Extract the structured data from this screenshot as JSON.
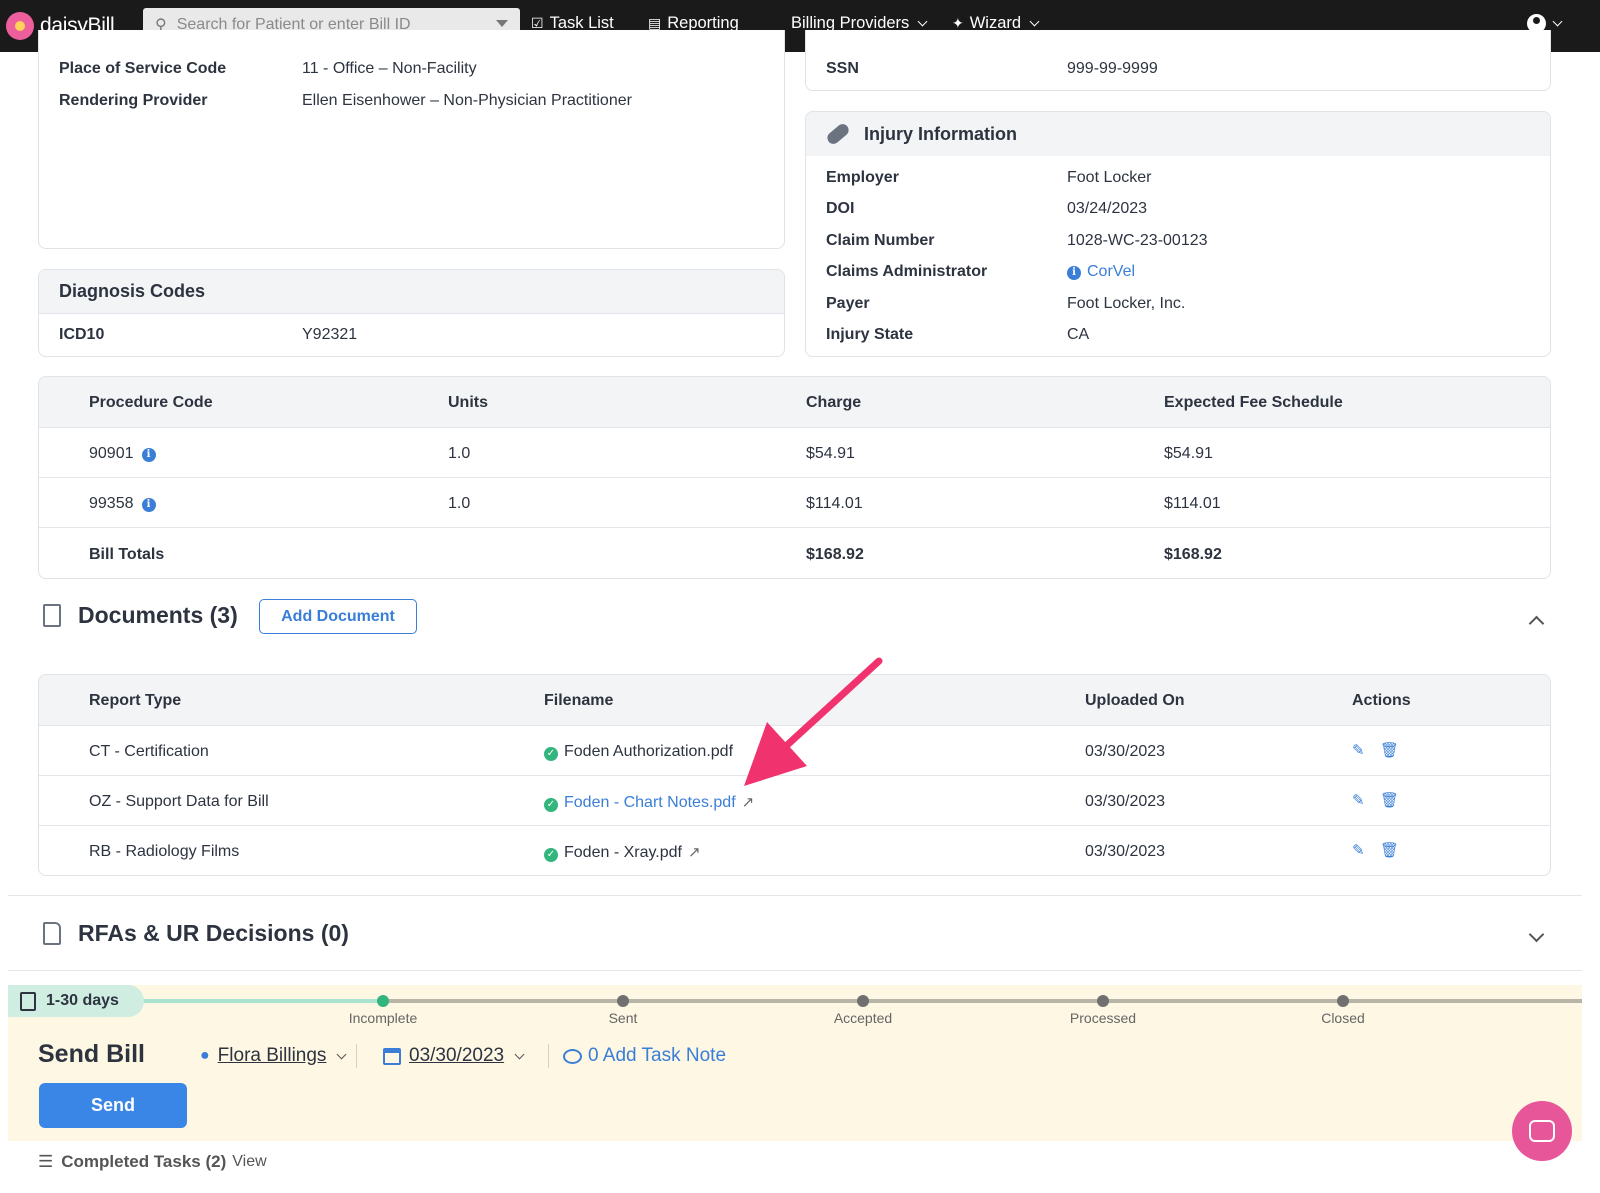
{
  "app": {
    "logo_text": "daisyBill"
  },
  "nav": {
    "search_placeholder": "Search for Patient or enter Bill ID",
    "task_list": "Task List",
    "reporting": "Reporting",
    "billing_providers": "Billing Providers",
    "wizard": "Wizard"
  },
  "service": {
    "rows": [
      {
        "label": "Place of Service Code",
        "value": "11 - Office – Non-Facility"
      },
      {
        "label": "Rendering Provider",
        "value": "Ellen Eisenhower – Non-Physician Practitioner"
      }
    ]
  },
  "patient": {
    "ssn_label": "SSN",
    "ssn_value": "999-99-9999"
  },
  "injury": {
    "title": "Injury Information",
    "rows": [
      {
        "label": "Employer",
        "value": "Foot Locker"
      },
      {
        "label": "DOI",
        "value": "03/24/2023"
      },
      {
        "label": "Claim Number",
        "value": "1028-WC-23-00123"
      },
      {
        "label": "Claims Administrator",
        "value": "CorVel"
      },
      {
        "label": "Payer",
        "value": "Foot Locker, Inc."
      },
      {
        "label": "Injury State",
        "value": "CA"
      }
    ]
  },
  "diagnosis": {
    "title": "Diagnosis Codes",
    "label": "ICD10",
    "value": "Y92321"
  },
  "procedures": {
    "headers": [
      "Procedure Code",
      "Units",
      "Charge",
      "Expected Fee Schedule"
    ],
    "rows": [
      {
        "code": "90901",
        "units": "1.0",
        "charge": "$54.91",
        "expected": "$54.91"
      },
      {
        "code": "99358",
        "units": "1.0",
        "charge": "$114.01",
        "expected": "$114.01"
      }
    ],
    "totals": {
      "label": "Bill Totals",
      "charge": "$168.92",
      "expected": "$168.92"
    }
  },
  "documents": {
    "title": "Documents (3)",
    "add_label": "Add Document",
    "headers": [
      "Report Type",
      "Filename",
      "Uploaded On",
      "Actions"
    ],
    "rows": [
      {
        "type": "CT - Certification",
        "filename": "Foden Authorization.pdf",
        "uploaded": "03/30/2023"
      },
      {
        "type": "OZ - Support Data for Bill",
        "filename": "Foden - Chart Notes.pdf",
        "uploaded": "03/30/2023"
      },
      {
        "type": "RB - Radiology Films",
        "filename": "Foden - Xray.pdf",
        "uploaded": "03/30/2023"
      }
    ]
  },
  "rfas": {
    "title": "RFAs & UR Decisions (0)"
  },
  "task": {
    "days_badge": "1-30 days",
    "stages": [
      "Incomplete",
      "Sent",
      "Accepted",
      "Processed",
      "Closed"
    ],
    "title": "Send Bill",
    "assignee": "Flora Billings",
    "date": "03/30/2023",
    "task_note": "0 Add Task Note",
    "send_label": "Send",
    "completed": "Completed Tasks (2)",
    "view": "View"
  },
  "colors": {
    "accent": "#3a7ed8",
    "success": "#33b57e",
    "annotation_arrow": "#f0336f",
    "task_bg": "#fdf7e3",
    "chat": "#e8569a"
  }
}
